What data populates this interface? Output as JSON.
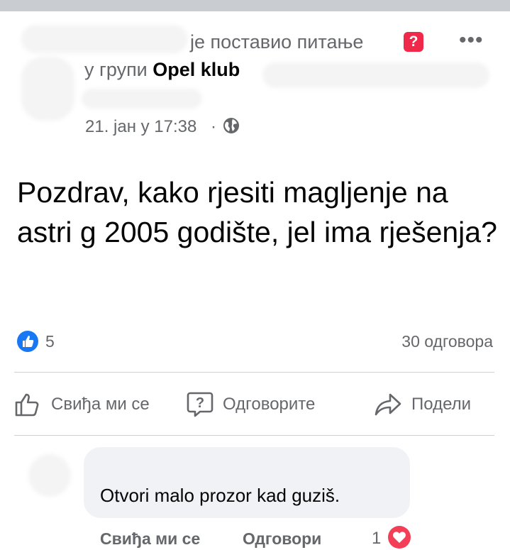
{
  "post": {
    "header_action": "је поставио питање",
    "question_badge": "?",
    "group_prefix": "у групи",
    "group_name": "Opel klub",
    "timestamp": "21. јан у 17:38",
    "separator": "·",
    "more_icon": "more-horizontal-icon",
    "text": "Pozdrav, kako rjesiti magljenje na astri g 2005 godište, jel ima rješenja?"
  },
  "stats": {
    "likes": "5",
    "answers": "30 одговора"
  },
  "actions": {
    "like_label": "Свиђа ми се",
    "answer_label": "Одговорите",
    "share_label": "Подели"
  },
  "comment": {
    "text": "Otvori malo prozor kad guziš.",
    "like_label": "Свиђа ми се",
    "reply_label": "Одговори",
    "reaction_count": "1"
  },
  "colors": {
    "accent_blue": "#1877f2",
    "question_red": "#f02849",
    "heart_red": "#f33e58",
    "muted_text": "#65676b",
    "bubble_bg": "#f0f2f5"
  }
}
